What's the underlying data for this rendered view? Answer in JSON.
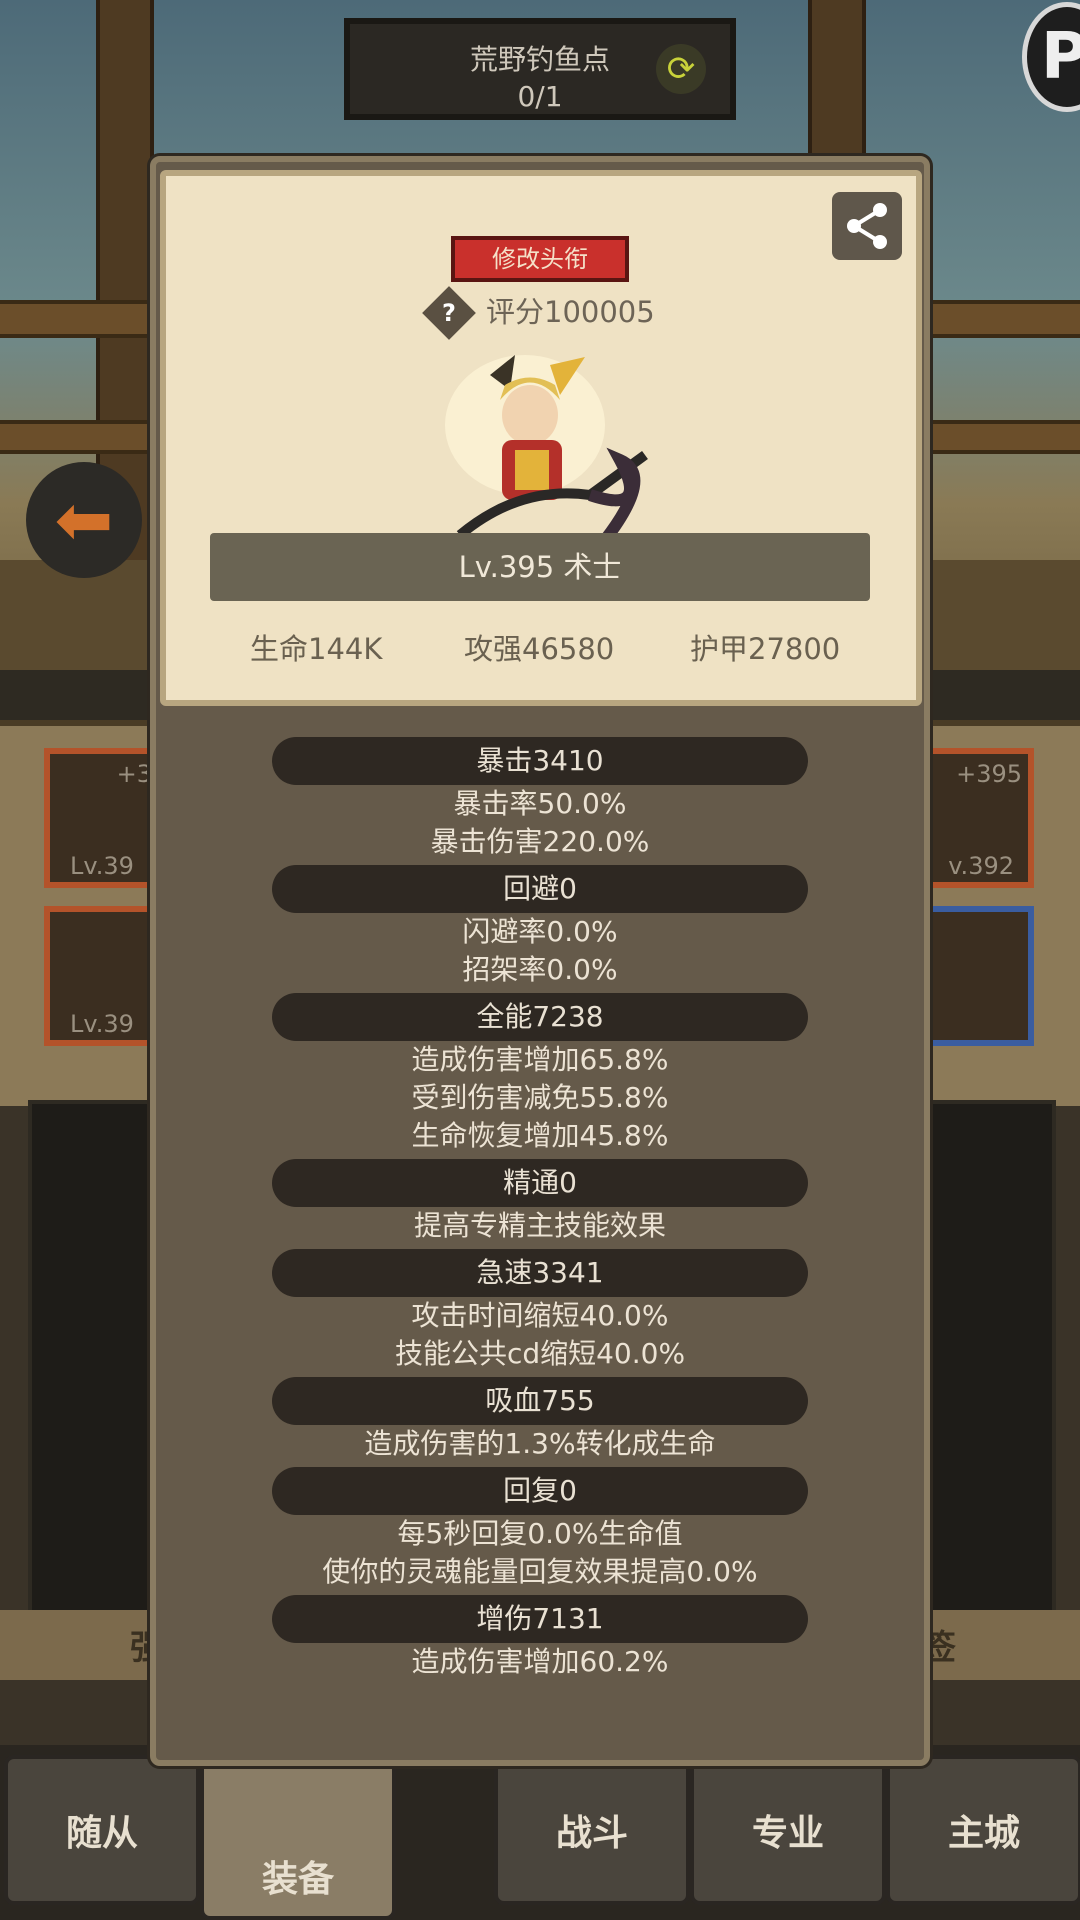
{
  "location": {
    "title": "荒野钓鱼点",
    "count": "0/1"
  },
  "brand_letter": "P",
  "profile": {
    "rename_label": "修改头衔",
    "help_symbol": "?",
    "score": "评分100005",
    "level_class": "Lv.395 术士",
    "hp": "生命144K",
    "attack": "攻强46580",
    "armor": "护甲27800"
  },
  "stats": [
    {
      "header": "暴击3410",
      "details": [
        "暴击率50.0%",
        "暴击伤害220.0%"
      ]
    },
    {
      "header": "回避0",
      "details": [
        "闪避率0.0%",
        "招架率0.0%"
      ]
    },
    {
      "header": "全能7238",
      "details": [
        "造成伤害增加65.8%",
        "受到伤害减免55.8%",
        "生命恢复增加45.8%"
      ]
    },
    {
      "header": "精通0",
      "details": [
        "提高专精主技能效果"
      ]
    },
    {
      "header": "急速3341",
      "details": [
        "攻击时间缩短40.0%",
        "技能公共cd缩短40.0%"
      ]
    },
    {
      "header": "吸血755",
      "details": [
        "造成伤害的1.3%转化成生命"
      ]
    },
    {
      "header": "回复0",
      "details": [
        "每5秒回复0.0%生命值",
        "使你的灵魂能量回复效果提高0.0%"
      ]
    },
    {
      "header": "增伤7131",
      "details": [
        "造成伤害增加60.2%"
      ]
    }
  ],
  "background_slots": {
    "left_top_plus": "+3",
    "left_top_level": "Lv.39",
    "left_bottom_level": "Lv.39",
    "right_top_plus": "+395",
    "right_top_level": "v.392"
  },
  "bottom_partial": {
    "left": "强",
    "right": "签"
  },
  "nav": {
    "follower": "随从",
    "equipment": "装备",
    "battle": "战斗",
    "profession": "专业",
    "main_city": "主城"
  },
  "colors": {
    "rename_button": "#c9302c",
    "card_bg": "#efe2c4",
    "modal_bg": "#655a4a",
    "stat_header_bg": "#2e2822"
  }
}
